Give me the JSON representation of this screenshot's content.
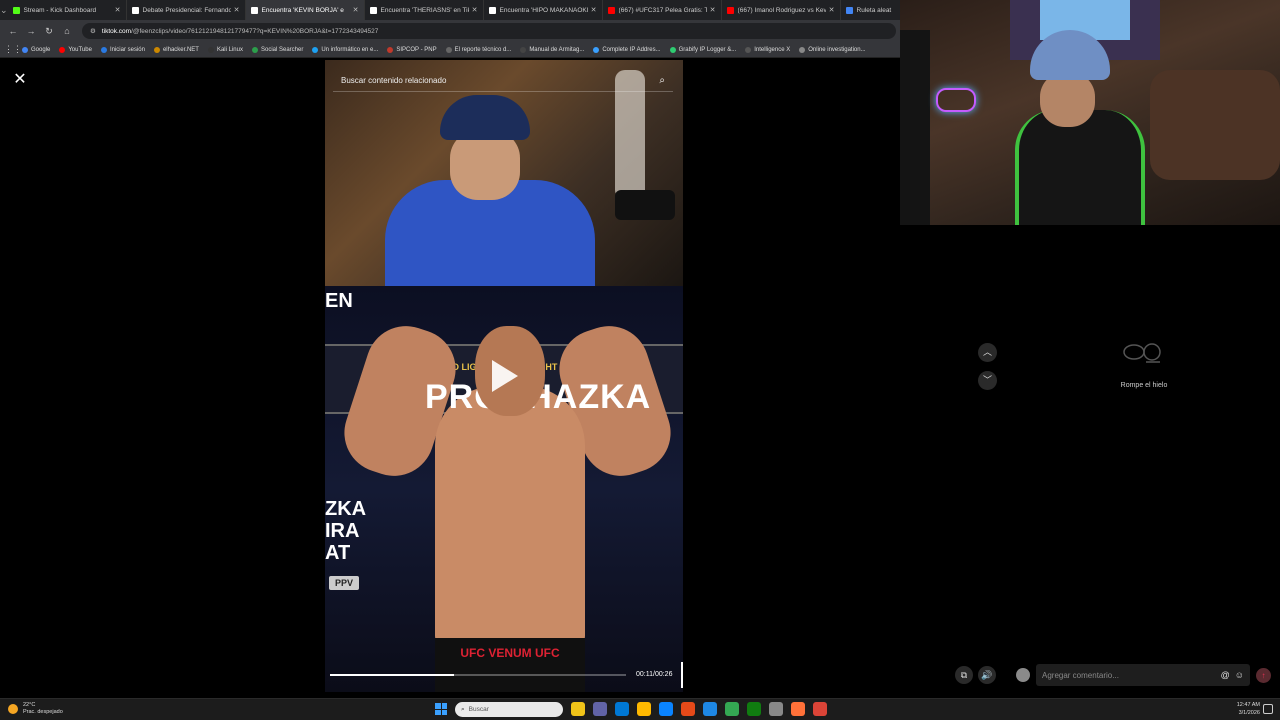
{
  "browser": {
    "tabs": [
      {
        "title": "Stream - Kick Dashboard",
        "color": "#53fc18",
        "active": false
      },
      {
        "title": "Debate Presidencial: Fernando",
        "color": "#ffffff",
        "active": false
      },
      {
        "title": "Encuentra 'KEVIN BORJA' e",
        "color": "#ffffff",
        "active": true
      },
      {
        "title": "Encuentra 'THERIASNS' en TikT",
        "color": "#ffffff",
        "active": false
      },
      {
        "title": "Encuentra 'HIPO MAKANAOKI'",
        "color": "#ffffff",
        "active": false
      },
      {
        "title": "(667) #UFC317 Pelea Gratis: Top",
        "color": "#ff0000",
        "active": false
      },
      {
        "title": "(667) Imanol Rodriguez vs Kevi",
        "color": "#ff0000",
        "active": false
      },
      {
        "title": "Ruleta aleat",
        "color": "#4285f4",
        "active": false
      }
    ],
    "url_host": "tiktok.com",
    "url_path": "/@feenzclips/video/7612121948121779477?q=KEVIN%20BORJA&t=1772343494527",
    "bookmarks": [
      {
        "label": "Google",
        "color": "#4285f4"
      },
      {
        "label": "YouTube",
        "color": "#ff0000"
      },
      {
        "label": "Iniciar sesión",
        "color": "#2a7ae2"
      },
      {
        "label": "elhacker.NET",
        "color": "#cc8800"
      },
      {
        "label": "Kali Linux",
        "color": "#333333"
      },
      {
        "label": "Social Searcher",
        "color": "#2c9e4b"
      },
      {
        "label": "Un informático en e...",
        "color": "#1da1f2"
      },
      {
        "label": "SIPCOP - PNP",
        "color": "#c0392b"
      },
      {
        "label": "El reporte técnico d...",
        "color": "#666666"
      },
      {
        "label": "Manual de Armitag...",
        "color": "#444444"
      },
      {
        "label": "Complete IP Addres...",
        "color": "#3aa0ff"
      },
      {
        "label": "Grabify IP Logger &...",
        "color": "#2ecc71"
      },
      {
        "label": "Intelligence X",
        "color": "#555555"
      },
      {
        "label": "Online investigation...",
        "color": "#888888"
      }
    ]
  },
  "video": {
    "search_placeholder": "Buscar contenido relacionado",
    "banner_top": "WORLD LIGHT HEAVYWEIGHT CHAMPIONSHIP",
    "banner_text": "PROCHAZKA",
    "corner_text": "EN",
    "side_text": "ZKA IRA AT",
    "ppv": "PPV",
    "shorts_text": "UFC VENUM UFC",
    "timecode": "00:11/00:26",
    "progress": 0.42
  },
  "sidebar": {
    "empty_text": "Rompe el hielo",
    "comment_placeholder": "Agregar comentario..."
  },
  "taskbar": {
    "temp": "22°C",
    "weather": "Prac. despejado",
    "search_placeholder": "Buscar",
    "time": "12:47 AM",
    "date": "3/1/2026",
    "apps": [
      "#f0c419",
      "#6264a7",
      "#0078d4",
      "#ffb900",
      "#0a84ff",
      "#e64a19",
      "#1e88e5",
      "#34a853",
      "#107c10",
      "#888888",
      "#ff7139",
      "#db4437"
    ]
  }
}
